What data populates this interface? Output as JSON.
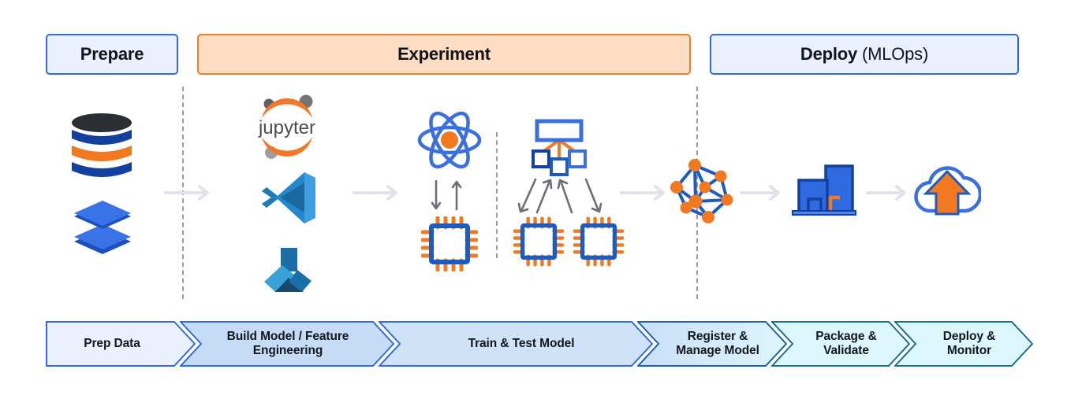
{
  "phases": [
    {
      "id": "prepare",
      "bold": "Prepare",
      "rest": ""
    },
    {
      "id": "experiment",
      "bold": "Experiment",
      "rest": ""
    },
    {
      "id": "deploy",
      "bold": "Deploy",
      "rest": " (MLOps)"
    }
  ],
  "tools": {
    "jupyter_wordmark": "jupyter",
    "names": [
      "database-icon",
      "data-layers-icon",
      "jupyter-logo",
      "vscode-logo",
      "azure-ml-logo",
      "atom-icon",
      "cpu-chip-icon",
      "model-hierarchy-icon",
      "network-graph-icon",
      "model-registry-building-icon",
      "cloud-upload-icon"
    ]
  },
  "ribbon": {
    "steps": [
      {
        "id": "prep-data",
        "line1": "Prep Data",
        "line2": ""
      },
      {
        "id": "build-model",
        "line1": "Build Model / Feature",
        "line2": "Engineering"
      },
      {
        "id": "train-test",
        "line1": "Train & Test Model",
        "line2": ""
      },
      {
        "id": "register-manage",
        "line1": "Register &",
        "line2": "Manage Model"
      },
      {
        "id": "package-validate",
        "line1": "Package &",
        "line2": "Validate"
      },
      {
        "id": "deploy-monitor",
        "line1": "Deploy &",
        "line2": "Monitor"
      }
    ]
  },
  "colors": {
    "blue_border": "#2f6ae0",
    "blue_fill": "#eaf0fe",
    "orange_border": "#f07d28",
    "orange_fill": "#fdddc3",
    "accent_orange": "#f2791f",
    "accent_blue": "#1c5bbf",
    "teal_border": "#1b6e8c",
    "cyan_fill": "#dcf7fb",
    "arrow_gray": "#e2e2ef",
    "dash_gray": "#9b9ba3"
  }
}
